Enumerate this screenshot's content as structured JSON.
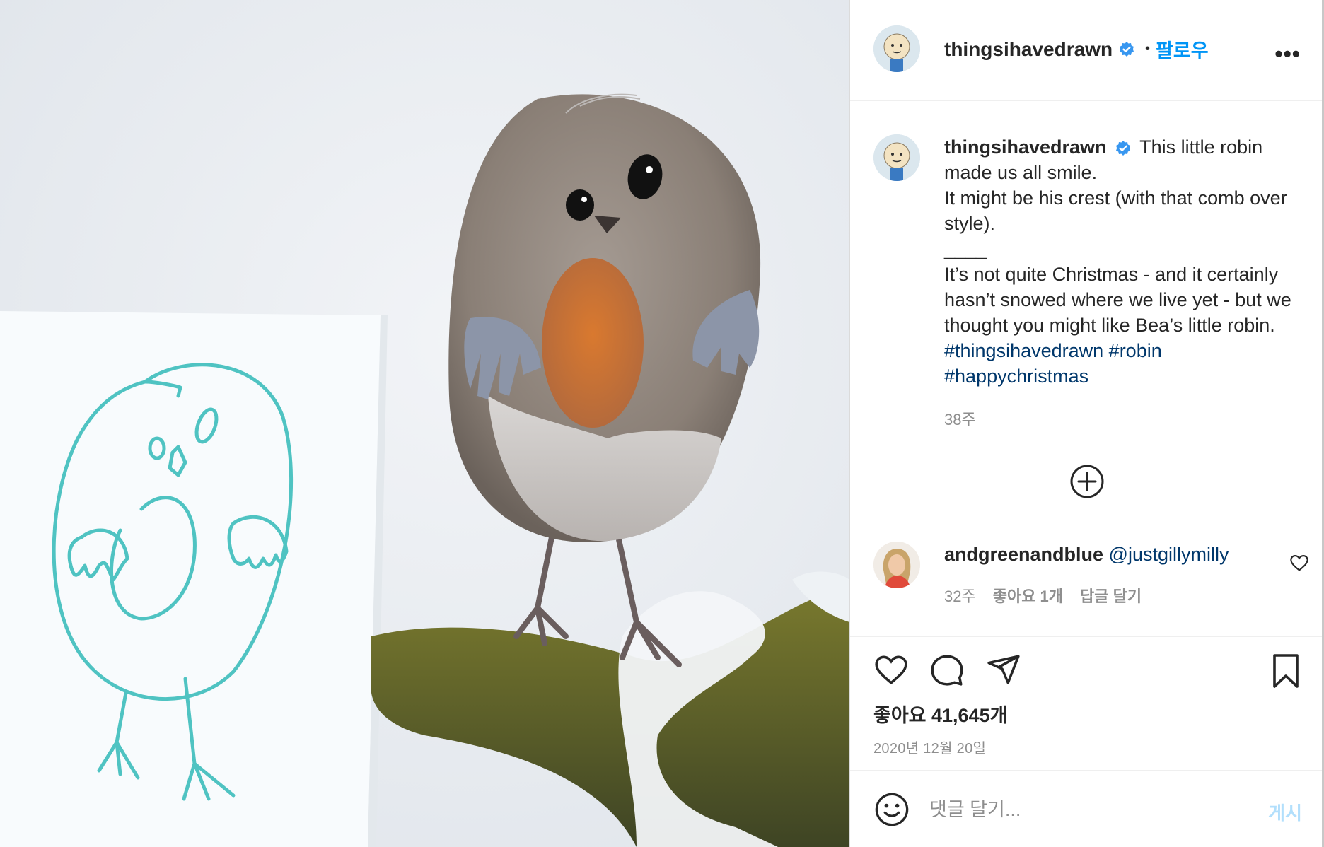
{
  "header": {
    "username": "thingsihavedrawn",
    "separator": "•",
    "follow_label": "팔로우",
    "more_label": "•••"
  },
  "caption": {
    "username": "thingsihavedrawn",
    "line1_text": "This little robin made us all smile.",
    "line2_text": "It might be his crest (with that comb over style).",
    "divider": "____",
    "body_text": "It’s not quite Christmas - and it certainly hasn’t snowed where we live yet - but we thought you might like Bea’s little robin.",
    "hashtags": [
      "#thingsihavedrawn",
      "#robin",
      "#happychristmas"
    ],
    "time_ago": "38주"
  },
  "comment": {
    "username": "andgreenandblue",
    "mention": "@justgillymilly",
    "time_ago": "32주",
    "likes": "좋아요 1개",
    "reply_label": "답글 달기"
  },
  "actions": {
    "icons": [
      "heart-icon",
      "comment-icon",
      "share-icon",
      "bookmark-icon"
    ]
  },
  "post": {
    "likes_text": "좋아요 41,645개",
    "date_text": "2020년 12월 20일"
  },
  "compose": {
    "placeholder": "댓글 달기...",
    "post_label": "게시"
  },
  "colors": {
    "accent": "#0095f6",
    "verified": "#3897f0",
    "hashtag": "#00376b",
    "muted": "#8e8e8e",
    "drawing": "#4fc3c2"
  }
}
